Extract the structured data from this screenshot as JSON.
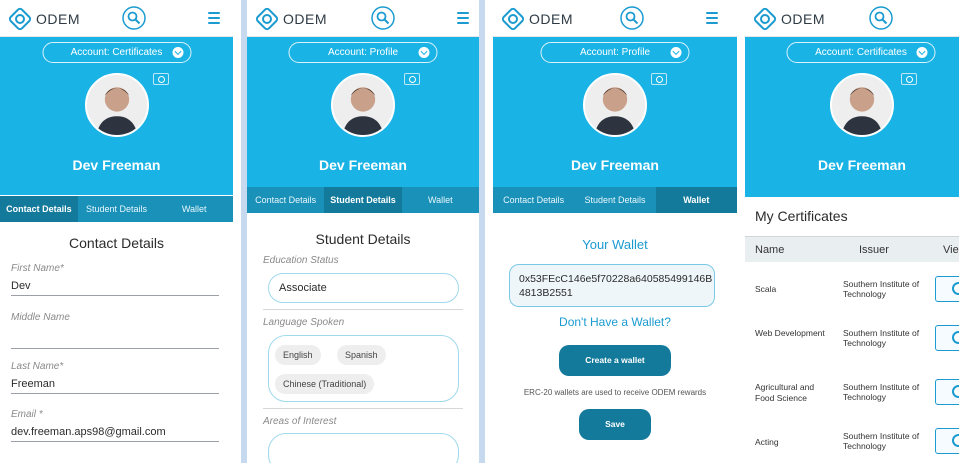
{
  "app": {
    "brand": "ODEM"
  },
  "colors": {
    "hero": "#1ab3e6",
    "tab_bar": "#1a91b8",
    "tab_active": "#137a9c",
    "accent": "#1b9bd0"
  },
  "screen1": {
    "account_label": "Account: Certificates",
    "user_name": "Dev Freeman",
    "tabs": [
      "Contact Details",
      "Student Details",
      "Wallet"
    ],
    "section_title": "Contact Details",
    "fields": [
      {
        "label": "First Name*",
        "value": "Dev"
      },
      {
        "label": "Middle Name",
        "value": ""
      },
      {
        "label": "Last Name*",
        "value": "Freeman"
      },
      {
        "label": "Email *",
        "value": "dev.freeman.aps98@gmail.com"
      }
    ]
  },
  "screen2": {
    "account_label": "Account: Profile",
    "user_name": "Dev Freeman",
    "tabs": [
      "Contact Details",
      "Student Details",
      "Wallet"
    ],
    "section_title": "Student Details",
    "education_label": "Education Status",
    "education_value": "Associate",
    "language_label": "Language Spoken",
    "languages": [
      "English",
      "Spanish",
      "Chinese (Traditional)"
    ],
    "interest_label": "Areas of Interest"
  },
  "screen3": {
    "account_label": "Account: Profile",
    "user_name": "Dev Freeman",
    "tabs": [
      "Contact Details",
      "Student Details",
      "Wallet"
    ],
    "wallet_title": "Your Wallet",
    "wallet_address": "0x53FEcC146e5f70228a640585499146B4813B2551",
    "no_wallet_link": "Don't Have a Wallet?",
    "create_button": "Create a wallet",
    "note": "ERC-20 wallets are used to receive ODEM rewards",
    "save_button": "Save"
  },
  "screen4": {
    "account_label": "Account: Certificates",
    "user_name": "Dev Freeman",
    "title": "My Certificates",
    "columns": [
      "Name",
      "Issuer",
      "Vie"
    ],
    "rows": [
      {
        "name": "Scala",
        "issuer": "Southern Institute of Technology"
      },
      {
        "name": "Web Development",
        "issuer": "Southern Institute of Technology"
      },
      {
        "name": "Agricultural and Food Science",
        "issuer": "Southern Institute of Technology"
      },
      {
        "name": "Acting",
        "issuer": "Southern Institute of Technology"
      }
    ]
  }
}
